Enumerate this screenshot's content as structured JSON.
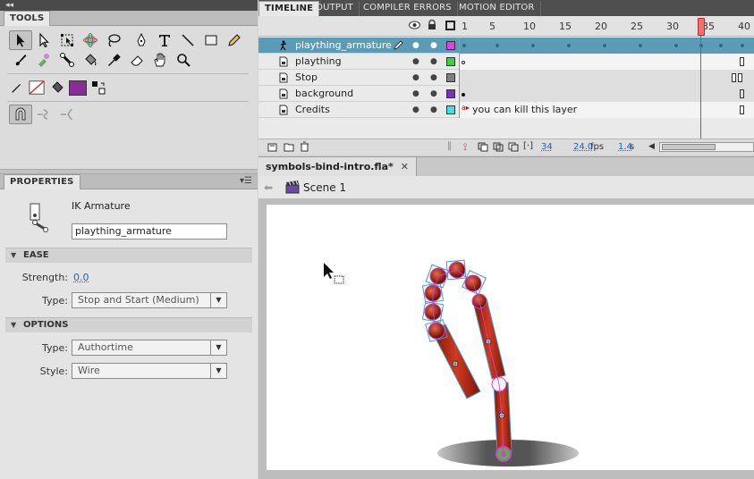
{
  "tools_panel": {
    "title": "TOOLS"
  },
  "properties_panel": {
    "title": "PROPERTIES",
    "object_type": "IK Armature",
    "instance_name": "plaything_armature",
    "ease": {
      "header": "EASE",
      "strength_label": "Strength:",
      "strength_value": "0.0",
      "type_label": "Type:",
      "type_value": "Stop and Start (Medium)"
    },
    "options": {
      "header": "OPTIONS",
      "type_label": "Type:",
      "type_value": "Authortime",
      "style_label": "Style:",
      "style_value": "Wire"
    }
  },
  "timeline": {
    "tabs": [
      "TIMELINE",
      "OUTPUT",
      "COMPILER ERRORS",
      "MOTION EDITOR"
    ],
    "ruler": [
      "1",
      "5",
      "10",
      "15",
      "20",
      "25",
      "30",
      "35",
      "40"
    ],
    "layers": [
      {
        "name": "plaything_armature",
        "color": "#e040e0"
      },
      {
        "name": "plaything",
        "color": "#40d040"
      },
      {
        "name": "Stop",
        "color": "#808080"
      },
      {
        "name": "background",
        "color": "#7a30c0"
      },
      {
        "name": "Credits",
        "color": "#40e0e0"
      }
    ],
    "credits_frame_label": "you can kill this layer",
    "current_frame": "34",
    "fps": "24.0",
    "fps_unit": "fps",
    "elapsed": "1.4",
    "elapsed_unit": "s"
  },
  "document": {
    "tab_title": "symbols-bind-intro.fla*",
    "scene": "Scene 1"
  },
  "colors": {
    "fill_swatch": "#8a2a9c",
    "selected_layer": "#5b9bb5",
    "bone_red": "#c0321a"
  }
}
